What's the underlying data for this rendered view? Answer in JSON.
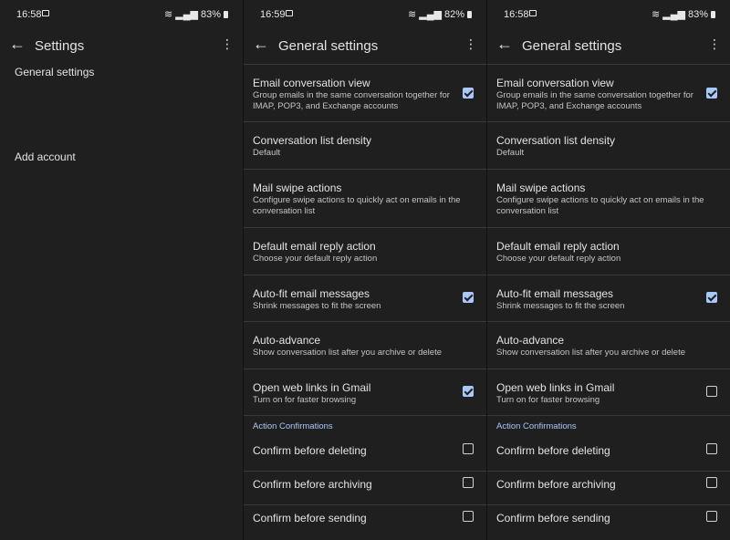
{
  "panel1": {
    "status": {
      "time": "16:58",
      "battery": "83%"
    },
    "title": "Settings",
    "items": [
      "General settings",
      "Add account"
    ]
  },
  "panel2": {
    "status": {
      "time": "16:59",
      "battery": "82%"
    },
    "title": "General settings",
    "rows": [
      {
        "title": "Email conversation view",
        "subtitle": "Group emails in the same conversation together for IMAP, POP3, and Exchange accounts",
        "checked": true
      },
      {
        "title": "Conversation list density",
        "subtitle": "Default"
      },
      {
        "title": "Mail swipe actions",
        "subtitle": "Configure swipe actions to quickly act on emails in the conversation list"
      },
      {
        "title": "Default email reply action",
        "subtitle": "Choose your default reply action"
      },
      {
        "title": "Auto-fit email messages",
        "subtitle": "Shrink messages to fit the screen",
        "checked": true
      },
      {
        "title": "Auto-advance",
        "subtitle": "Show conversation list after you archive or delete"
      },
      {
        "title": "Open web links in Gmail",
        "subtitle": "Turn on for faster browsing",
        "checked": true
      }
    ],
    "section": "Action Confirmations",
    "confirm": [
      {
        "title": "Confirm before deleting",
        "checked": false
      },
      {
        "title": "Confirm before archiving",
        "checked": false
      },
      {
        "title": "Confirm before sending",
        "checked": false
      }
    ]
  },
  "panel3": {
    "status": {
      "time": "16:58",
      "battery": "83%"
    },
    "title": "General settings",
    "rows": [
      {
        "title": "Email conversation view",
        "subtitle": "Group emails in the same conversation together for IMAP, POP3, and Exchange accounts",
        "checked": true
      },
      {
        "title": "Conversation list density",
        "subtitle": "Default"
      },
      {
        "title": "Mail swipe actions",
        "subtitle": "Configure swipe actions to quickly act on emails in the conversation list"
      },
      {
        "title": "Default email reply action",
        "subtitle": "Choose your default reply action"
      },
      {
        "title": "Auto-fit email messages",
        "subtitle": "Shrink messages to fit the screen",
        "checked": true
      },
      {
        "title": "Auto-advance",
        "subtitle": "Show conversation list after you archive or delete"
      },
      {
        "title": "Open web links in Gmail",
        "subtitle": "Turn on for faster browsing",
        "checked": false
      }
    ],
    "section": "Action Confirmations",
    "confirm": [
      {
        "title": "Confirm before deleting",
        "checked": false
      },
      {
        "title": "Confirm before archiving",
        "checked": false
      },
      {
        "title": "Confirm before sending",
        "checked": false
      }
    ]
  },
  "icons": {
    "back": "arrow-back-icon",
    "menu": "more-vert-icon"
  },
  "colors": {
    "background": "#1f1f1f",
    "accent": "#a8c7fa",
    "divider": "#3a3a3a"
  }
}
